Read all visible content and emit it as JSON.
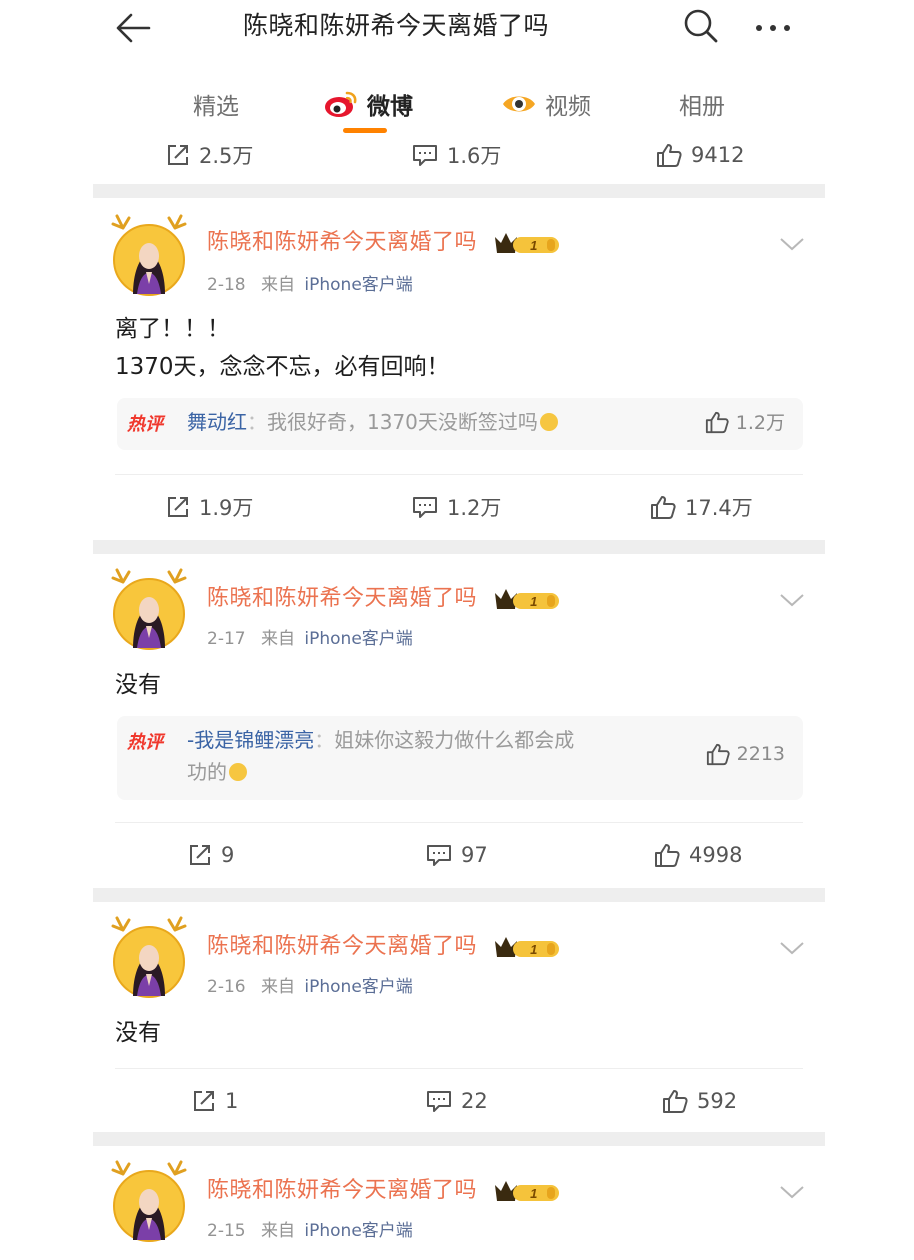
{
  "header": {
    "title": "陈晓和陈妍希今天离婚了吗"
  },
  "tabs": [
    {
      "label": "精选",
      "active": false
    },
    {
      "label": "微博",
      "active": true
    },
    {
      "label": "视频",
      "active": false
    },
    {
      "label": "相册",
      "active": false
    }
  ],
  "partial_actions": {
    "repost": "2.5万",
    "comment": "1.6万",
    "like": "9412"
  },
  "posts": [
    {
      "username": "陈晓和陈妍希今天离婚了吗",
      "vip_level": "1",
      "date": "2-18",
      "from_label": "来自",
      "source": "iPhone客户端",
      "text_lines": [
        "离了！！！",
        "1370天，念念不忘，必有回响！"
      ],
      "hot_comment": {
        "tag": "热评",
        "user": "舞动红",
        "text": "我很好奇，1370天没断签过吗",
        "likes": "1.2万"
      },
      "repost": "1.9万",
      "comment": "1.2万",
      "like": "17.4万"
    },
    {
      "username": "陈晓和陈妍希今天离婚了吗",
      "vip_level": "1",
      "date": "2-17",
      "from_label": "来自",
      "source": "iPhone客户端",
      "text_lines": [
        "没有"
      ],
      "hot_comment": {
        "tag": "热评",
        "user": "-我是锦鲤漂亮",
        "text_line1": "姐妹你这毅力做什么都会成",
        "text_line2": "功的",
        "likes": "2213"
      },
      "repost": "9",
      "comment": "97",
      "like": "4998"
    },
    {
      "username": "陈晓和陈妍希今天离婚了吗",
      "vip_level": "1",
      "date": "2-16",
      "from_label": "来自",
      "source": "iPhone客户端",
      "text_lines": [
        "没有"
      ],
      "repost": "1",
      "comment": "22",
      "like": "592"
    },
    {
      "username": "陈晓和陈妍希今天离婚了吗",
      "vip_level": "1",
      "date": "2-15",
      "from_label": "来自",
      "source": "iPhone客户端"
    }
  ],
  "icons": {
    "back": "back-arrow-icon",
    "search": "search-icon",
    "more": "more-dots-icon",
    "weibo_tab": "weibo-logo-icon",
    "video_tab": "video-eye-icon",
    "repost": "repost-icon",
    "comment": "comment-icon",
    "like": "thumbs-up-icon",
    "chevron": "chevron-down-icon"
  },
  "colors": {
    "accent": "#ff8200",
    "username": "#eb7350",
    "hot_tag": "#f0382d",
    "link": "#5b6e96"
  }
}
